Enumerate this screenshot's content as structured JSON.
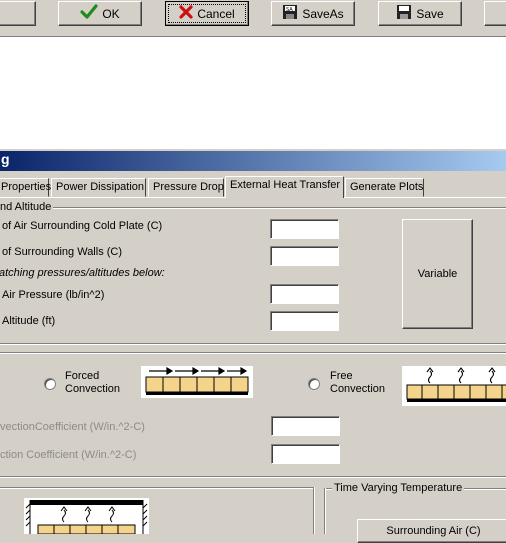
{
  "toolbar": {
    "ok_label": "OK",
    "cancel_label": "Cancel",
    "saveas_label": "SaveAs",
    "save_label": "Save"
  },
  "window": {
    "title_fragment": "g"
  },
  "tabs": [
    {
      "label": "Properties"
    },
    {
      "label": "Power Dissipation"
    },
    {
      "label": "Pressure Drop"
    },
    {
      "label": "External Heat Transfer"
    },
    {
      "label": "Generate Plots"
    }
  ],
  "temp_group": {
    "legend": "nd Altitude",
    "air_temp_label": "of Air Surrounding Cold Plate (C)",
    "air_temp_value": "",
    "wall_temp_label": "of Surrounding Walls (C)",
    "wall_temp_value": "",
    "note": "atching pressures/altitudes below:",
    "pressure_label": "Air Pressure (lb/in^2)",
    "pressure_value": "",
    "altitude_label": "Altitude (ft)",
    "altitude_value": "",
    "variable_label": "Variable"
  },
  "convection": {
    "forced_label_1": "Forced",
    "forced_label_2": "Convection",
    "free_label_1": "Free",
    "free_label_2": "Convection",
    "coef_label_1": "vectionCoefficient (W/in.^2-C)",
    "coef_value_1": "",
    "coef_label_2": "ction Coefficient (W/in.^2-C)",
    "coef_value_2": ""
  },
  "time_varying": {
    "legend": "Time Varying Temperature",
    "button_label": "Surrounding Air (C)"
  },
  "colors": {
    "face": "#d4d0c8",
    "title_start": "#0a246a",
    "title_end": "#a6caf0",
    "check_green": "#1f8a1f",
    "cancel_red": "#cc1111",
    "cold_plate_yellow": "#f3d48a"
  }
}
